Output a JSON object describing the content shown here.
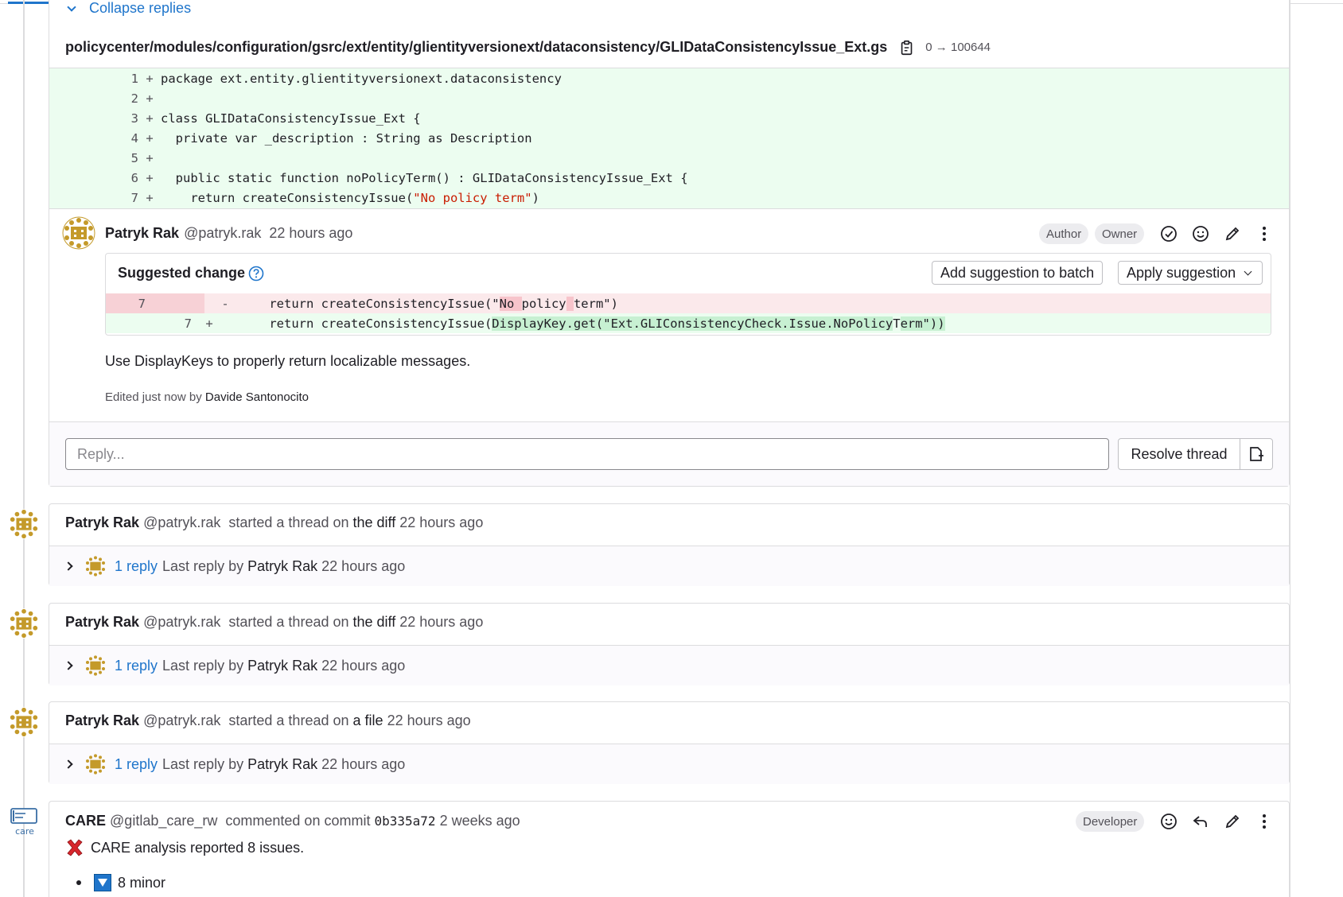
{
  "thread": {
    "collapse_label": "Collapse replies",
    "file_path": "policycenter/modules/configuration/gsrc/ext/entity/glientityversionext/dataconsistency/GLIDataConsistencyIssue_Ext.gs",
    "file_mode": "0 → 100644",
    "diff_lines": [
      {
        "num": "1",
        "sign": "+",
        "code": "package ext.entity.glientityversionext.dataconsistency"
      },
      {
        "num": "2",
        "sign": "+",
        "code": ""
      },
      {
        "num": "3",
        "sign": "+",
        "code": "class GLIDataConsistencyIssue_Ext {"
      },
      {
        "num": "4",
        "sign": "+",
        "code": "  private var _description : String as Description"
      },
      {
        "num": "5",
        "sign": "+",
        "code": ""
      },
      {
        "num": "6",
        "sign": "+",
        "code": "  public static function noPolicyTerm() : GLIDataConsistencyIssue_Ext {"
      },
      {
        "num": "7",
        "sign": "+",
        "code_pre": "    return createConsistencyIssue(",
        "code_str": "\"No policy term\"",
        "code_post": ")"
      }
    ],
    "note": {
      "author": "Patryk Rak",
      "handle": "@patryk.rak",
      "time": "22 hours ago",
      "badge_author": "Author",
      "badge_owner": "Owner",
      "suggested_change_label": "Suggested change",
      "add_batch_label": "Add suggestion to batch",
      "apply_label": "Apply suggestion",
      "old_line_num": "7",
      "old_sign": "-",
      "old_code_pre": "    return createConsistencyIssue(\"",
      "old_code_hl1": "No ",
      "old_code_mid": "policy",
      "old_code_hl2": " ",
      "old_code_post": "term\")",
      "new_line_num": "7",
      "new_sign": "+",
      "new_code_pre": "    return createConsistencyIssue(",
      "new_code_hl1": "DisplayKey.get(",
      "new_code_mid": "\"Ext.GLIConsistencyCheck.Issue.NoPolicy",
      "new_code_hl2": "T",
      "new_code_post": "erm\")",
      "new_code_hl3": ")",
      "body": "Use DisplayKeys to properly return localizable messages.",
      "edited_prefix": "Edited just now by",
      "edited_by": "Davide Santonocito"
    },
    "reply_placeholder": "Reply...",
    "resolve_label": "Resolve thread"
  },
  "collapsed_threads": [
    {
      "author": "Patryk Rak",
      "handle": "@patryk.rak",
      "action": "started a thread on",
      "target": "the diff",
      "time": "22 hours ago",
      "reply_count": "1 reply",
      "last_reply_prefix": "Last reply by",
      "last_reply_author": "Patryk Rak",
      "last_reply_time": "22 hours ago"
    },
    {
      "author": "Patryk Rak",
      "handle": "@patryk.rak",
      "action": "started a thread on",
      "target": "the diff",
      "time": "22 hours ago",
      "reply_count": "1 reply",
      "last_reply_prefix": "Last reply by",
      "last_reply_author": "Patryk Rak",
      "last_reply_time": "22 hours ago"
    },
    {
      "author": "Patryk Rak",
      "handle": "@patryk.rak",
      "action": "started a thread on",
      "target": "a file",
      "time": "22 hours ago",
      "reply_count": "1 reply",
      "last_reply_prefix": "Last reply by",
      "last_reply_author": "Patryk Rak",
      "last_reply_time": "22 hours ago"
    }
  ],
  "care_note": {
    "author": "CARE",
    "handle": "@gitlab_care_rw",
    "action": "commented on commit",
    "commit": "0b335a72",
    "time": "2 weeks ago",
    "badge": "Developer",
    "summary": "CARE analysis reported 8 issues.",
    "item": "8 minor",
    "avatar_text": "care"
  },
  "colors": {
    "link": "#1f75cb",
    "added_bg": "#ecfdf0",
    "removed_bg": "#fbe9eb",
    "string": "#c91c00",
    "avatar_gold": "#c49a2a"
  }
}
